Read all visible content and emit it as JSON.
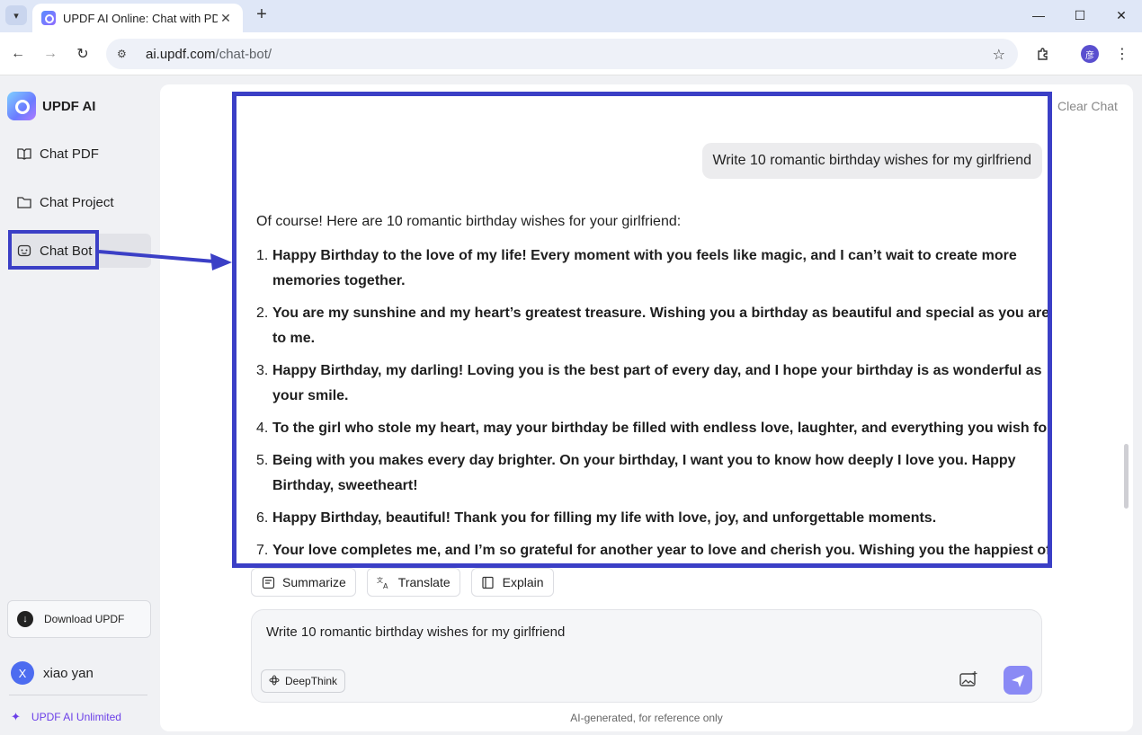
{
  "browser": {
    "tab_title": "UPDF AI Online: Chat with PDF",
    "url_host": "ai.updf.com",
    "url_path": "/chat-bot/",
    "profile_initial": "彦"
  },
  "sidebar": {
    "brand": "UPDF AI",
    "items": [
      {
        "label": "Chat PDF",
        "icon": "book-icon"
      },
      {
        "label": "Chat Project",
        "icon": "folder-icon"
      },
      {
        "label": "Chat Bot",
        "icon": "bot-icon",
        "active": true
      }
    ],
    "download_label": "Download UPDF",
    "user": {
      "initial": "X",
      "name": "xiao yan"
    },
    "unlimited_label": "UPDF AI Unlimited"
  },
  "main": {
    "clear_chat": "Clear Chat",
    "user_message": "Write 10 romantic birthday wishes for my girlfriend",
    "ai_intro": "Of course! Here are 10 romantic birthday wishes for your girlfriend:",
    "wishes": [
      {
        "num": "1.",
        "text": "Happy Birthday to the love of my life! Every moment with you feels like magic, and I can’t wait to create more memories together."
      },
      {
        "num": "2.",
        "text": "You are my sunshine and my heart’s greatest treasure. Wishing you a birthday as beautiful and special as you are to me."
      },
      {
        "num": "3.",
        "text": "Happy Birthday, my darling! Loving you is the best part of every day, and I hope your birthday is as wonderful as your smile."
      },
      {
        "num": "4.",
        "text": "To the girl who stole my heart, may your birthday be filled with endless love, laughter, and everything you wish for."
      },
      {
        "num": "5.",
        "text": "Being with you makes every day brighter. On your birthday, I want you to know how deeply I love you. Happy Birthday, sweetheart!"
      },
      {
        "num": "6.",
        "text": "Happy Birthday, beautiful! Thank you for filling my life with love, joy, and unforgettable moments."
      },
      {
        "num": "7.",
        "text": "Your love completes me, and I’m so grateful for another year to love and cherish you. Wishing you the happiest of"
      }
    ],
    "actions": {
      "summarize": "Summarize",
      "translate": "Translate",
      "explain": "Explain"
    },
    "composer_text": "Write 10 romantic birthday wishes for my girlfriend",
    "deepthink": "DeepThink",
    "disclaimer": "AI-generated, for reference only"
  },
  "colors": {
    "highlight": "#3b3fc6",
    "send": "#8a8af5",
    "accent": "#6b3fe8"
  }
}
